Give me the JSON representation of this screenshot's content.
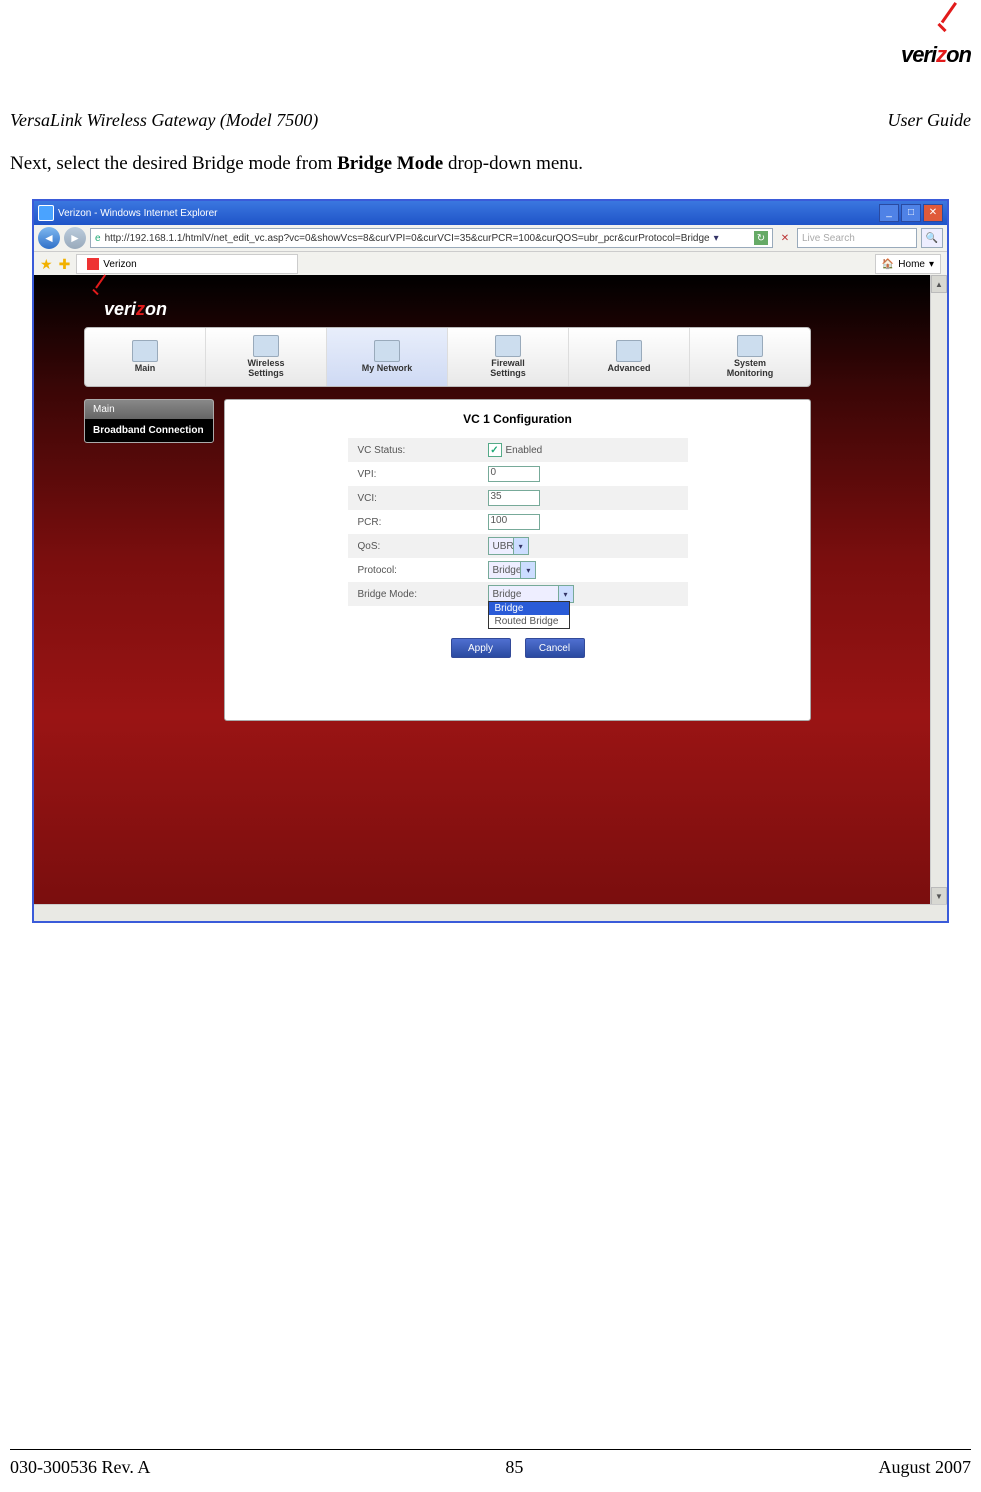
{
  "page_logo_text": "verizon",
  "doc_header": {
    "left": "VersaLink Wireless Gateway (Model 7500)",
    "right": "User Guide"
  },
  "body_pre": "Next, select the desired Bridge mode from ",
  "body_bold": "Bridge Mode",
  "body_post": " drop-down menu.",
  "browser": {
    "title": "Verizon - Windows Internet Explorer",
    "url": "http://192.168.1.1/htmlV/net_edit_vc.asp?vc=0&showVcs=8&curVPI=0&curVCI=35&curPCR=100&curQOS=ubr_pcr&curProtocol=Bridge",
    "search_placeholder": "Live Search",
    "tab_label": "Verizon",
    "home_label": "Home"
  },
  "router": {
    "logo": "verizon",
    "tabs": [
      {
        "label": "Main"
      },
      {
        "label": "Wireless\nSettings"
      },
      {
        "label": "My Network"
      },
      {
        "label": "Firewall\nSettings"
      },
      {
        "label": "Advanced"
      },
      {
        "label": "System\nMonitoring"
      }
    ],
    "sidebar": {
      "header": "Main",
      "item": "Broadband Connection"
    },
    "panel_title": "VC 1 Configuration",
    "fields": {
      "vc_status_label": "VC Status:",
      "vc_status_val": "Enabled",
      "vpi_label": "VPI:",
      "vpi_val": "0",
      "vci_label": "VCI:",
      "vci_val": "35",
      "pcr_label": "PCR:",
      "pcr_val": "100",
      "qos_label": "QoS:",
      "qos_val": "UBR",
      "proto_label": "Protocol:",
      "proto_val": "Bridge",
      "bmode_label": "Bridge Mode:",
      "bmode_val": "Bridge",
      "bmode_options": [
        "Bridge",
        "Routed Bridge"
      ]
    },
    "buttons": {
      "apply": "Apply",
      "cancel": "Cancel"
    }
  },
  "footer": {
    "left": "030-300536 Rev. A",
    "center": "85",
    "right": "August 2007"
  }
}
